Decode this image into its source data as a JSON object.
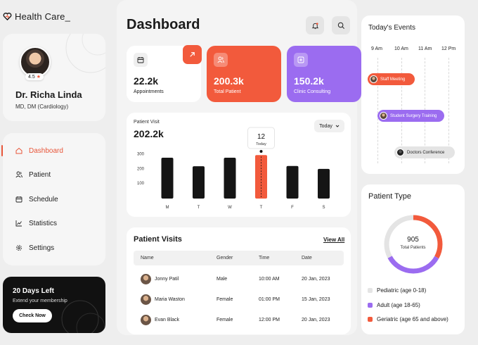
{
  "brand": {
    "name": "Health Care_"
  },
  "profile": {
    "name": "Dr. Richa Linda",
    "title": "MD, DM  (Cardiology)",
    "rating": "4.5"
  },
  "nav": {
    "items": [
      {
        "label": "Dashboard",
        "icon": "home-icon",
        "active": true
      },
      {
        "label": "Patient",
        "icon": "users-icon",
        "active": false
      },
      {
        "label": "Schedule",
        "icon": "calendar-icon",
        "active": false
      },
      {
        "label": "Statistics",
        "icon": "chart-icon",
        "active": false
      },
      {
        "label": "Settings",
        "icon": "gear-icon",
        "active": false
      }
    ]
  },
  "promo": {
    "title": "20 Days Left",
    "subtitle": "Extend your membership",
    "button": "Check Now"
  },
  "header": {
    "title": "Dashboard"
  },
  "stats": [
    {
      "value": "22.2k",
      "label": "Appointments",
      "icon": "calendar-icon"
    },
    {
      "value": "200.3k",
      "label": "Total Patient",
      "icon": "users-icon"
    },
    {
      "value": "150.2k",
      "label": "Clinic Consulting",
      "icon": "medical-cross-icon"
    }
  ],
  "patient_visit": {
    "label": "Patient Visit",
    "total": "202.2k",
    "period": "Today",
    "tooltip": {
      "value": "12",
      "label": "Today"
    }
  },
  "chart_data": {
    "type": "bar",
    "categories": [
      "M",
      "T",
      "W",
      "T",
      "F",
      "S"
    ],
    "values": [
      272,
      213,
      272,
      290,
      215,
      195
    ],
    "highlight_index": 3,
    "yticks": [
      "300",
      "200",
      "100"
    ],
    "ylim": [
      0,
      330
    ],
    "colors": {
      "bar": "#151515",
      "highlight": "#f25a3c"
    }
  },
  "visits_table": {
    "title": "Patient Visits",
    "view_all": "View All",
    "columns": [
      "Name",
      "Gender",
      "Time",
      "Date"
    ],
    "rows": [
      {
        "name": "Jonny Patil",
        "gender": "Male",
        "time": "10:00 AM",
        "date": "20 Jan, 2023"
      },
      {
        "name": "Maria Waston",
        "gender": "Female",
        "time": "01:00 PM",
        "date": "15 Jan, 2023"
      },
      {
        "name": "Evan Black",
        "gender": "Female",
        "time": "12:00 PM",
        "date": "20 Jan, 2023"
      }
    ]
  },
  "events": {
    "title": "Today's Events",
    "times": [
      "9 Am",
      "10 Am",
      "11 Am",
      "12 Pm"
    ],
    "items": [
      {
        "label": "Staff Meeting",
        "color": "#f25a3c",
        "text_color": "#ffffff"
      },
      {
        "label": "Student Surgery Training",
        "color": "#9b6cf0",
        "text_color": "#ffffff"
      },
      {
        "label": "Doctors Conference",
        "color": "#e4e4e4",
        "text_color": "#222222"
      }
    ]
  },
  "patient_type": {
    "title": "Patient Type",
    "total": "905",
    "total_label": "Total Patients",
    "segments": [
      {
        "label": "Pediatric (age 0-18)",
        "color": "#e4e4e4",
        "fraction": 0.33
      },
      {
        "label": "Adult (age 18-65)",
        "color": "#9b6cf0",
        "fraction": 0.34
      },
      {
        "label": "Geriatric (age 65 and above)",
        "color": "#f25a3c",
        "fraction": 0.33
      }
    ]
  }
}
